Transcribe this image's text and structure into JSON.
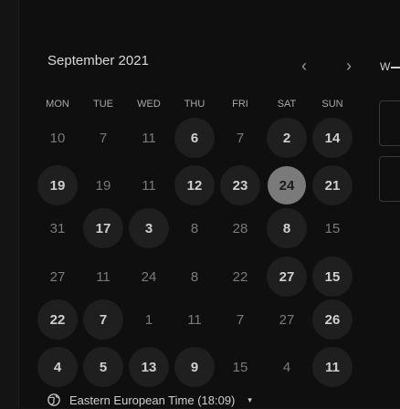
{
  "calendar": {
    "month_label": "September 2021",
    "prev_icon": "‹",
    "next_icon": "›",
    "side_label": "W",
    "weekdays": [
      "MON",
      "TUE",
      "WED",
      "THU",
      "FRI",
      "SAT",
      "SUN"
    ],
    "weeks": [
      [
        {
          "d": "10",
          "s": "plain"
        },
        {
          "d": "7",
          "s": "plain"
        },
        {
          "d": "11",
          "s": "plain"
        },
        {
          "d": "6",
          "s": "available"
        },
        {
          "d": "7",
          "s": "plain"
        },
        {
          "d": "2",
          "s": "available"
        },
        {
          "d": "14",
          "s": "available"
        }
      ],
      [
        {
          "d": "19",
          "s": "available"
        },
        {
          "d": "19",
          "s": "plain"
        },
        {
          "d": "11",
          "s": "plain"
        },
        {
          "d": "12",
          "s": "available"
        },
        {
          "d": "23",
          "s": "available"
        },
        {
          "d": "24",
          "s": "selected"
        },
        {
          "d": "21",
          "s": "available"
        }
      ],
      [
        {
          "d": "31",
          "s": "plain"
        },
        {
          "d": "17",
          "s": "available"
        },
        {
          "d": "3",
          "s": "available"
        },
        {
          "d": "8",
          "s": "plain"
        },
        {
          "d": "28",
          "s": "plain"
        },
        {
          "d": "8",
          "s": "available"
        },
        {
          "d": "15",
          "s": "plain"
        }
      ],
      [
        {
          "d": "27",
          "s": "plain"
        },
        {
          "d": "11",
          "s": "plain"
        },
        {
          "d": "24",
          "s": "plain"
        },
        {
          "d": "8",
          "s": "plain"
        },
        {
          "d": "22",
          "s": "plain"
        },
        {
          "d": "27",
          "s": "available"
        },
        {
          "d": "15",
          "s": "available"
        }
      ],
      [
        {
          "d": "22",
          "s": "available"
        },
        {
          "d": "7",
          "s": "available"
        },
        {
          "d": "1",
          "s": "plain"
        },
        {
          "d": "11",
          "s": "plain"
        },
        {
          "d": "7",
          "s": "plain"
        },
        {
          "d": "27",
          "s": "plain"
        },
        {
          "d": "26",
          "s": "available"
        }
      ],
      [
        {
          "d": "4",
          "s": "available"
        },
        {
          "d": "5",
          "s": "available"
        },
        {
          "d": "13",
          "s": "available"
        },
        {
          "d": "9",
          "s": "available"
        },
        {
          "d": "15",
          "s": "plain"
        },
        {
          "d": "4",
          "s": "plain"
        },
        {
          "d": "11",
          "s": "available"
        }
      ]
    ]
  },
  "timezone": {
    "label": "Eastern European Time (18:09)",
    "icon": "globe-icon",
    "caret": "▾"
  },
  "colors": {
    "background": "#0f0f0f",
    "available_bg": "#1f1f1f",
    "selected_bg": "#7a7a7a"
  }
}
